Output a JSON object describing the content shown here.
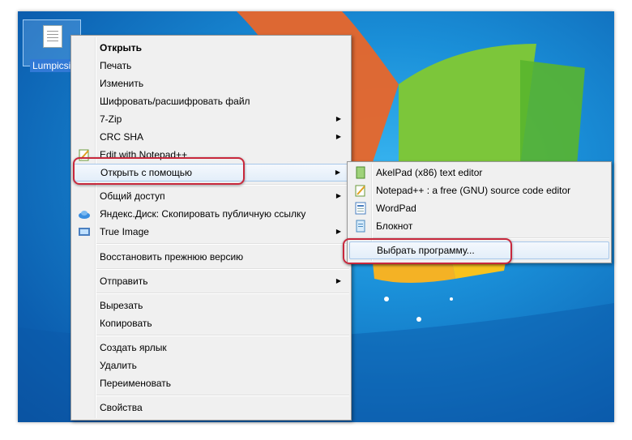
{
  "desktop": {
    "file_icon_label": "Lumpicsit"
  },
  "context_menu": {
    "items": [
      {
        "label": "Открыть"
      },
      {
        "label": "Печать"
      },
      {
        "label": "Изменить"
      },
      {
        "label": "Шифровать/расшифровать файл"
      },
      {
        "label": "7-Zip"
      },
      {
        "label": "CRC SHA"
      },
      {
        "label": "Edit with Notepad++"
      },
      {
        "label": "Открыть с помощью"
      },
      {
        "label": "Общий доступ"
      },
      {
        "label": "Яндекс.Диск: Скопировать публичную ссылку"
      },
      {
        "label": "True Image"
      },
      {
        "label": "Восстановить прежнюю версию"
      },
      {
        "label": "Отправить"
      },
      {
        "label": "Вырезать"
      },
      {
        "label": "Копировать"
      },
      {
        "label": "Создать ярлык"
      },
      {
        "label": "Удалить"
      },
      {
        "label": "Переименовать"
      },
      {
        "label": "Свойства"
      }
    ]
  },
  "open_with_submenu": {
    "items": [
      {
        "label": "AkelPad (x86) text editor"
      },
      {
        "label": "Notepad++ : a free (GNU) source code editor"
      },
      {
        "label": "WordPad"
      },
      {
        "label": "Блокнот"
      },
      {
        "label": "Выбрать программу..."
      }
    ]
  },
  "colors": {
    "highlight_border": "#c8283c",
    "menu_bg": "#f0f0f0"
  }
}
